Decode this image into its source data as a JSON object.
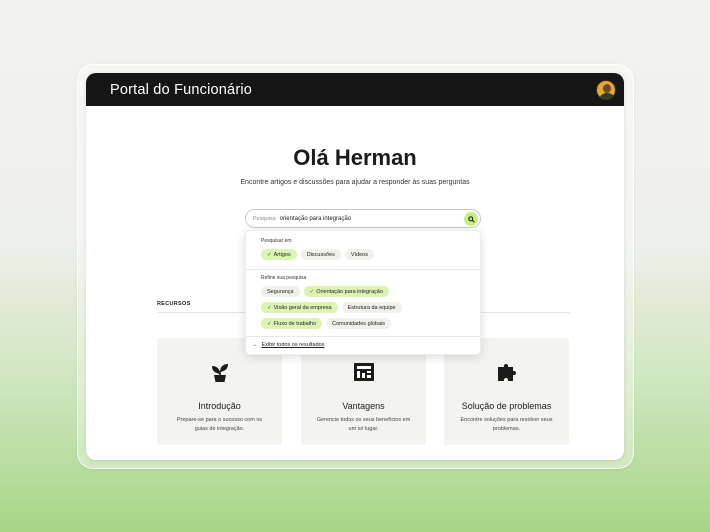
{
  "app": {
    "title": "Portal do Funcionário"
  },
  "greeting": {
    "title": "Olá Herman",
    "subtitle": "Encontre artigos e discussões para ajudar a responder às suas perguntas"
  },
  "search": {
    "label": "Pesquisa",
    "value": "orientação para integração"
  },
  "dropdown": {
    "search_in_label": "Pesquisar em",
    "search_in": [
      {
        "label": "Artigos",
        "selected": true
      },
      {
        "label": "Discussões",
        "selected": false
      },
      {
        "label": "Vídeos",
        "selected": false
      }
    ],
    "refine_label": "Refine sua pesquisa",
    "refine": [
      [
        {
          "label": "Segurança",
          "selected": false
        },
        {
          "label": "Orientação para integração",
          "selected": true
        }
      ],
      [
        {
          "label": "Visão geral da empresa",
          "selected": true
        },
        {
          "label": "Estrutura da equipe",
          "selected": false
        }
      ],
      [
        {
          "label": "Fluxo de trabalho",
          "selected": true
        },
        {
          "label": "Comunidades globais",
          "selected": false
        }
      ]
    ],
    "show_all": "Exibir todos os resultados"
  },
  "resources": {
    "label": "RECURSOS",
    "cards": [
      {
        "icon": "plant-icon",
        "title": "Introdução",
        "desc": "Prepare-se para o sucesso com os guias de integração."
      },
      {
        "icon": "dashboard-icon",
        "title": "Vantagens",
        "desc": "Gerencie todos os seus benefícios em um só lugar."
      },
      {
        "icon": "puzzle-icon",
        "title": "Solução de problemas",
        "desc": "Encontre soluções para resolver seus problemas."
      }
    ]
  },
  "colors": {
    "accent": "#c8ec86",
    "chip_selected": "#ddf3b3",
    "topbar": "#161616"
  }
}
